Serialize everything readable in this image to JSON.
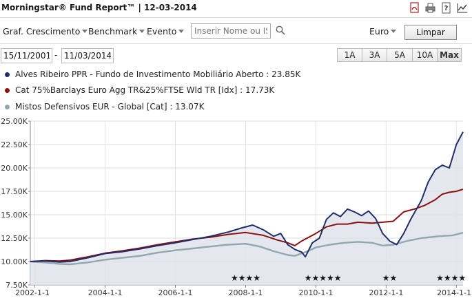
{
  "header": {
    "title": "Morningstar® Fund Report™ | 12-03-2014"
  },
  "toolbar": {
    "menus": [
      {
        "label": "Graf. Crescimento"
      },
      {
        "label": "Benchmark"
      },
      {
        "label": "Evento"
      }
    ],
    "search_placeholder": "Inserir Nome ou IS",
    "currency": "Euro",
    "clear_label": "Limpar"
  },
  "dates": {
    "start": "15/11/2001",
    "separator": "-",
    "end": "11/03/2014"
  },
  "ranges": [
    "1A",
    "3A",
    "5A",
    "10A",
    "Max"
  ],
  "active_range": "Max",
  "legend": [
    {
      "label": "Alves Ribeiro PPR - Fundo de Investimento Mobiliário Aberto : 23.85K",
      "color": "#1f2d6b"
    },
    {
      "label": "Cat 75%Barclays Euro Agg TR&25%FTSE Wld TR [Idx] : 17.73K",
      "color": "#8a1010"
    },
    {
      "label": "Mistos Defensivos EUR - Global [Cat] : 13.07K",
      "color": "#8fa8b0"
    }
  ],
  "chart_data": {
    "type": "line",
    "yticks": [
      "7.50K",
      "10.00K",
      "12.50K",
      "15.00K",
      "17.50K",
      "20.00K",
      "22.50K",
      "25.00K"
    ],
    "ylim": [
      7500,
      25000
    ],
    "xticks": [
      "2002-1-1",
      "2004-1-1",
      "2006-1-1",
      "2008-1-1",
      "2010-1-1",
      "2012-1-1",
      "2014-1-1"
    ],
    "xlim": [
      2001.87,
      2014.19
    ],
    "ratings": [
      {
        "stars": "★★★★",
        "x": 2008.0
      },
      {
        "stars": "★★★★★",
        "x": 2010.2
      },
      {
        "stars": "★★",
        "x": 2012.1
      },
      {
        "stars": "★★★★",
        "x": 2013.85
      }
    ],
    "series": [
      {
        "name": "Alves Ribeiro PPR - Fundo de Investimento Mobiliário Aberto",
        "color": "#1f2d6b",
        "points": [
          [
            2001.87,
            10000
          ],
          [
            2002.3,
            10050
          ],
          [
            2002.7,
            9950
          ],
          [
            2003.0,
            10000
          ],
          [
            2003.5,
            10400
          ],
          [
            2004.0,
            10850
          ],
          [
            2004.5,
            11050
          ],
          [
            2005.0,
            11350
          ],
          [
            2005.5,
            11700
          ],
          [
            2006.0,
            12000
          ],
          [
            2006.5,
            12350
          ],
          [
            2007.0,
            12700
          ],
          [
            2007.5,
            13150
          ],
          [
            2007.9,
            13600
          ],
          [
            2008.2,
            13900
          ],
          [
            2008.5,
            13400
          ],
          [
            2008.8,
            12700
          ],
          [
            2009.0,
            13000
          ],
          [
            2009.2,
            11800
          ],
          [
            2009.4,
            11300
          ],
          [
            2009.6,
            11000
          ],
          [
            2009.7,
            10500
          ],
          [
            2009.9,
            12000
          ],
          [
            2010.1,
            12500
          ],
          [
            2010.3,
            14500
          ],
          [
            2010.5,
            15200
          ],
          [
            2010.7,
            14800
          ],
          [
            2010.9,
            15600
          ],
          [
            2011.1,
            15300
          ],
          [
            2011.3,
            14900
          ],
          [
            2011.5,
            15400
          ],
          [
            2011.7,
            14600
          ],
          [
            2011.9,
            13000
          ],
          [
            2012.1,
            12200
          ],
          [
            2012.3,
            11800
          ],
          [
            2012.5,
            13000
          ],
          [
            2012.7,
            14500
          ],
          [
            2013.0,
            16500
          ],
          [
            2013.2,
            18500
          ],
          [
            2013.4,
            19800
          ],
          [
            2013.6,
            20300
          ],
          [
            2013.8,
            20000
          ],
          [
            2014.0,
            22500
          ],
          [
            2014.19,
            23850
          ]
        ]
      },
      {
        "name": "Cat 75%Barclays Euro Agg TR&25%FTSE Wld TR [Idx]",
        "color": "#8a1010",
        "points": [
          [
            2001.87,
            10000
          ],
          [
            2002.3,
            10100
          ],
          [
            2002.7,
            10050
          ],
          [
            2003.0,
            10150
          ],
          [
            2003.5,
            10500
          ],
          [
            2004.0,
            10900
          ],
          [
            2004.5,
            11150
          ],
          [
            2005.0,
            11450
          ],
          [
            2005.5,
            11800
          ],
          [
            2006.0,
            12100
          ],
          [
            2006.5,
            12400
          ],
          [
            2007.0,
            12600
          ],
          [
            2007.5,
            12900
          ],
          [
            2008.0,
            13100
          ],
          [
            2008.5,
            12800
          ],
          [
            2008.9,
            12300
          ],
          [
            2009.2,
            12000
          ],
          [
            2009.4,
            11700
          ],
          [
            2009.6,
            12200
          ],
          [
            2010.0,
            13000
          ],
          [
            2010.3,
            13700
          ],
          [
            2010.6,
            14000
          ],
          [
            2010.9,
            14000
          ],
          [
            2011.2,
            14200
          ],
          [
            2011.6,
            14100
          ],
          [
            2011.9,
            14200
          ],
          [
            2012.2,
            14300
          ],
          [
            2012.5,
            15300
          ],
          [
            2012.8,
            15600
          ],
          [
            2013.1,
            16000
          ],
          [
            2013.4,
            16600
          ],
          [
            2013.6,
            17200
          ],
          [
            2013.8,
            17400
          ],
          [
            2014.0,
            17500
          ],
          [
            2014.19,
            17730
          ]
        ]
      },
      {
        "name": "Mistos Defensivos EUR - Global [Cat]",
        "color": "#8fa8b0",
        "points": [
          [
            2001.87,
            10000
          ],
          [
            2002.3,
            9900
          ],
          [
            2002.7,
            9750
          ],
          [
            2003.0,
            9700
          ],
          [
            2003.5,
            9900
          ],
          [
            2004.0,
            10200
          ],
          [
            2004.5,
            10400
          ],
          [
            2005.0,
            10600
          ],
          [
            2005.5,
            10950
          ],
          [
            2006.0,
            11200
          ],
          [
            2006.5,
            11400
          ],
          [
            2007.0,
            11600
          ],
          [
            2007.5,
            11800
          ],
          [
            2008.0,
            11900
          ],
          [
            2008.4,
            11600
          ],
          [
            2008.8,
            11100
          ],
          [
            2009.2,
            10700
          ],
          [
            2009.4,
            10600
          ],
          [
            2009.7,
            11000
          ],
          [
            2010.0,
            11500
          ],
          [
            2010.4,
            11800
          ],
          [
            2010.8,
            12000
          ],
          [
            2011.2,
            12100
          ],
          [
            2011.6,
            12000
          ],
          [
            2011.9,
            11700
          ],
          [
            2012.2,
            11800
          ],
          [
            2012.6,
            12200
          ],
          [
            2013.0,
            12500
          ],
          [
            2013.5,
            12700
          ],
          [
            2013.9,
            12800
          ],
          [
            2014.19,
            13070
          ]
        ]
      }
    ]
  }
}
